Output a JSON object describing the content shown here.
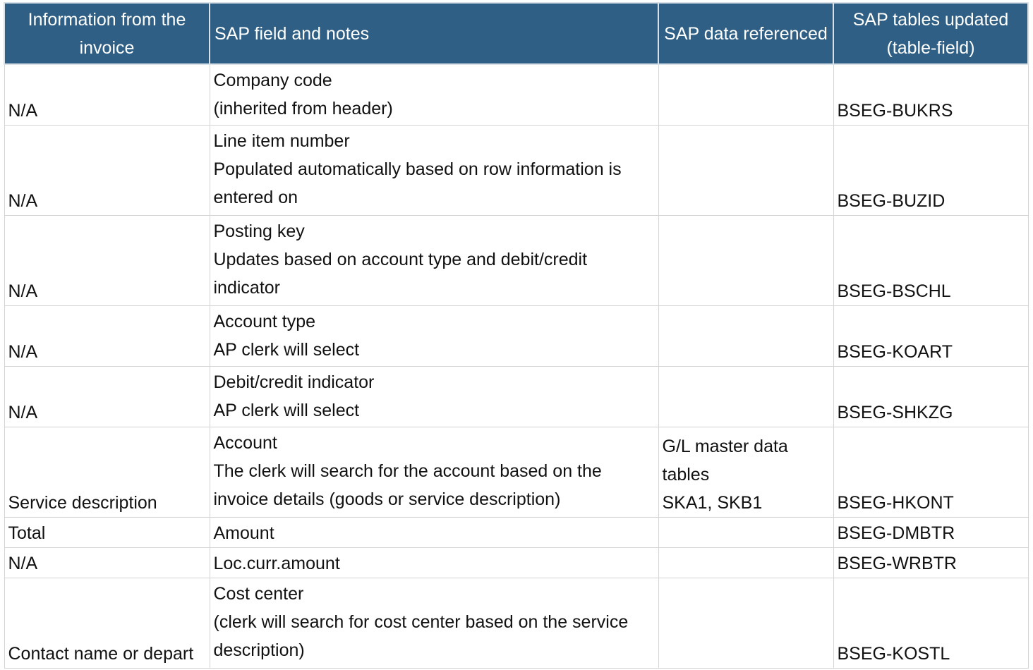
{
  "header": {
    "col1": "Information from the invoice",
    "col2": "SAP field and notes",
    "col3": "SAP data referenced",
    "col4": "SAP tables updated (table-field)"
  },
  "rows": [
    {
      "info": "N/A",
      "field": "Company code\n(inherited from header)",
      "ref": "",
      "table": "BSEG-BUKRS"
    },
    {
      "info": "N/A",
      "field": "Line item number\nPopulated automatically based on row information is entered on",
      "ref": "",
      "table": "BSEG-BUZID"
    },
    {
      "info": "N/A",
      "field": "Posting key\nUpdates based on account type and debit/credit indicator",
      "ref": "",
      "table": "BSEG-BSCHL"
    },
    {
      "info": "N/A",
      "field": "Account type\nAP clerk will select",
      "ref": "",
      "table": "BSEG-KOART"
    },
    {
      "info": "N/A",
      "field": "Debit/credit indicator\nAP clerk will select",
      "ref": "",
      "table": "BSEG-SHKZG"
    },
    {
      "info": "Service description",
      "field": "Account\nThe clerk will search for the account based on the invoice details (goods or service description)",
      "ref": "G/L master data tables\nSKA1, SKB1",
      "table": "BSEG-HKONT"
    },
    {
      "info": "Total",
      "field": "Amount",
      "ref": "",
      "table": "BSEG-DMBTR"
    },
    {
      "info": "N/A",
      "field": "Loc.curr.amount",
      "ref": "",
      "table": "BSEG-WRBTR"
    },
    {
      "info": "Contact name or depart",
      "field": "Cost center\n(clerk will search for cost center based on the service description)",
      "ref": "",
      "table": "BSEG-KOSTL"
    }
  ]
}
